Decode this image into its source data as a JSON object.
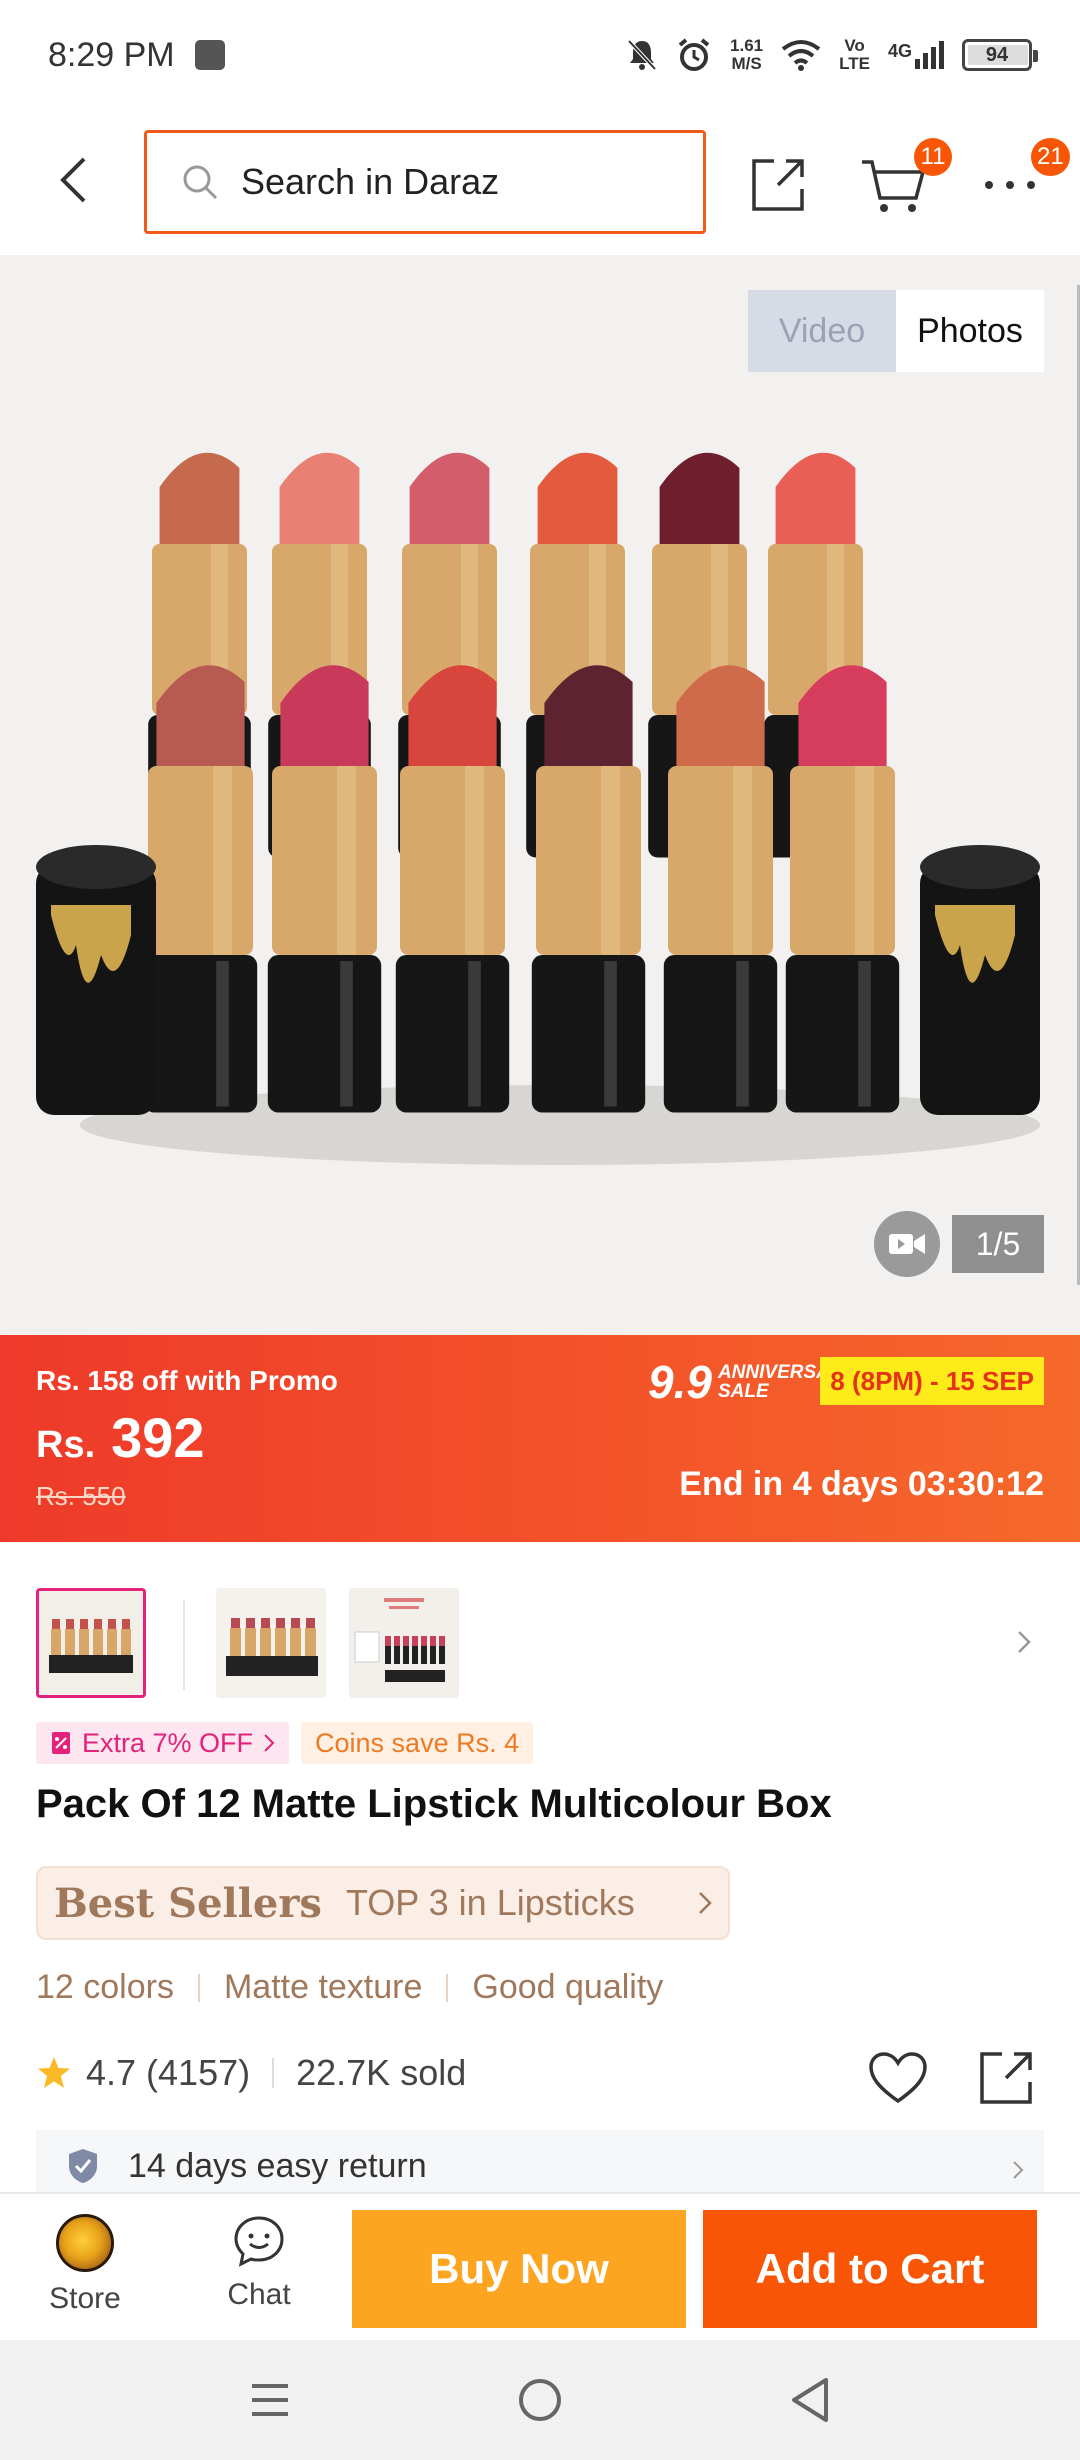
{
  "status_bar": {
    "time": "8:29 PM",
    "net_speed_value": "1.61",
    "net_speed_unit": "M/S",
    "volte_top": "Vo",
    "volte_bottom": "LTE",
    "network": "4G",
    "battery": "94"
  },
  "header": {
    "search_placeholder": "Search in Daraz",
    "cart_badge": "11",
    "more_badge": "21"
  },
  "gallery": {
    "tab_video": "Video",
    "tab_photos": "Photos",
    "counter": "1/5",
    "lipstick_shades_back": [
      "#c66a4e",
      "#e98074",
      "#d45d6c",
      "#e45a3f",
      "#6e1e2c",
      "#ea5f55"
    ],
    "lipstick_shades_front": [
      "#b75a52",
      "#c9395a",
      "#d8453c",
      "#5e2230",
      "#cf6a4a",
      "#d63c5c"
    ]
  },
  "promo": {
    "promo_text": "Rs. 158 off with Promo",
    "currency": "Rs.",
    "price": "392",
    "old_price": "Rs. 550",
    "sale_number": "9.9",
    "sale_word1": "ANNIVERSARY",
    "sale_word2": "SALE",
    "dates": "8 (8PM) - 15 SEP",
    "countdown": "End in 4 days 03:30:12"
  },
  "tags": {
    "extra": "Extra 7% OFF",
    "coins": "Coins save Rs. 4"
  },
  "product": {
    "title": "Pack Of 12 Matte Lipstick Multicolour Box",
    "bestseller_label": "Best Sellers",
    "bestseller_rank": "TOP 3 in Lipsticks",
    "features": [
      "12 colors",
      "Matte texture",
      "Good quality"
    ],
    "rating": "4.7 (4157)",
    "sold": "22.7K sold",
    "return_policy": "14 days easy return"
  },
  "bottom_bar": {
    "store": "Store",
    "chat": "Chat",
    "buy_now": "Buy Now",
    "add_to_cart": "Add to Cart"
  },
  "colors": {
    "brand_orange": "#f85606",
    "buy_yellow": "#fda520",
    "accent_pink": "#e3227b",
    "bestseller_brown": "#a0785b"
  }
}
